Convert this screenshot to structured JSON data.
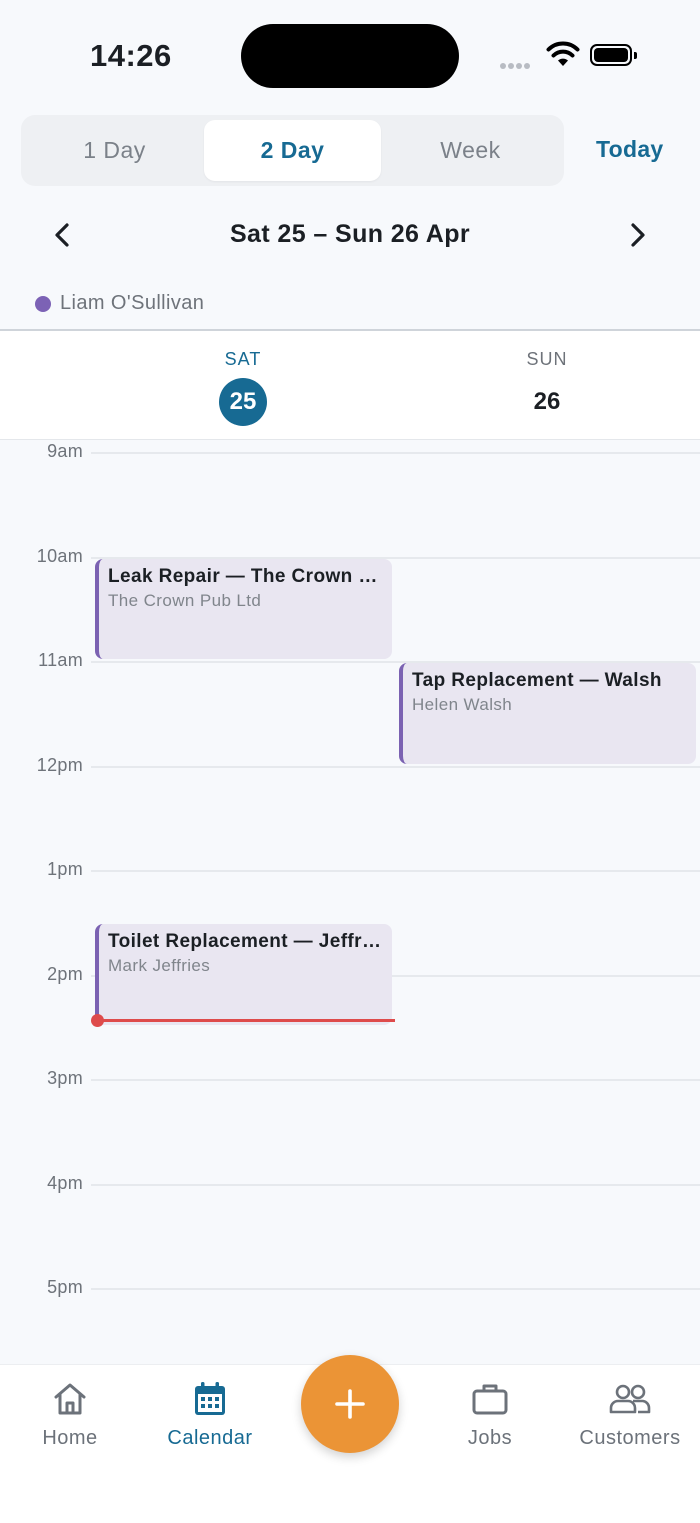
{
  "status_bar": {
    "time": "14:26"
  },
  "view_switcher": {
    "options": [
      "1 Day",
      "2 Day",
      "Week"
    ],
    "selected": "2 Day",
    "today_label": "Today"
  },
  "date_nav": {
    "range_label": "Sat 25 – Sun 26 Apr"
  },
  "staff_filter": {
    "name": "Liam O'Sullivan",
    "color": "#7c62b5"
  },
  "days": [
    {
      "name": "SAT",
      "number": "25",
      "is_today": true
    },
    {
      "name": "SUN",
      "number": "26",
      "is_today": false
    }
  ],
  "hours": [
    "9am",
    "10am",
    "11am",
    "12pm",
    "1pm",
    "2pm",
    "3pm",
    "4pm",
    "5pm"
  ],
  "events": [
    {
      "title": "Leak Repair — The Crown Pub",
      "subtitle": "The Crown Pub Ltd",
      "day": 0,
      "start": 10.0,
      "end": 11.0
    },
    {
      "title": "Tap Replacement — Walsh",
      "subtitle": "Helen Walsh",
      "day": 1,
      "start": 11.0,
      "end": 12.0
    },
    {
      "title": "Toilet Replacement — Jeffries",
      "subtitle": "Mark Jeffries",
      "day": 0,
      "start": 13.5,
      "end": 14.5
    }
  ],
  "current_time": 14.433,
  "colors": {
    "accent": "#176a93",
    "event_stripe": "#7b62b2",
    "event_bg": "#e9e6f1",
    "now_line": "#de4b4b",
    "fab": "#eb9436"
  },
  "tab_bar": {
    "tabs": [
      {
        "label": "Home",
        "icon": "home-icon"
      },
      {
        "label": "Calendar",
        "icon": "calendar-icon",
        "active": true
      },
      {
        "label": "Jobs",
        "icon": "briefcase-icon"
      },
      {
        "label": "Customers",
        "icon": "people-icon"
      }
    ],
    "fab_icon": "plus-icon"
  }
}
